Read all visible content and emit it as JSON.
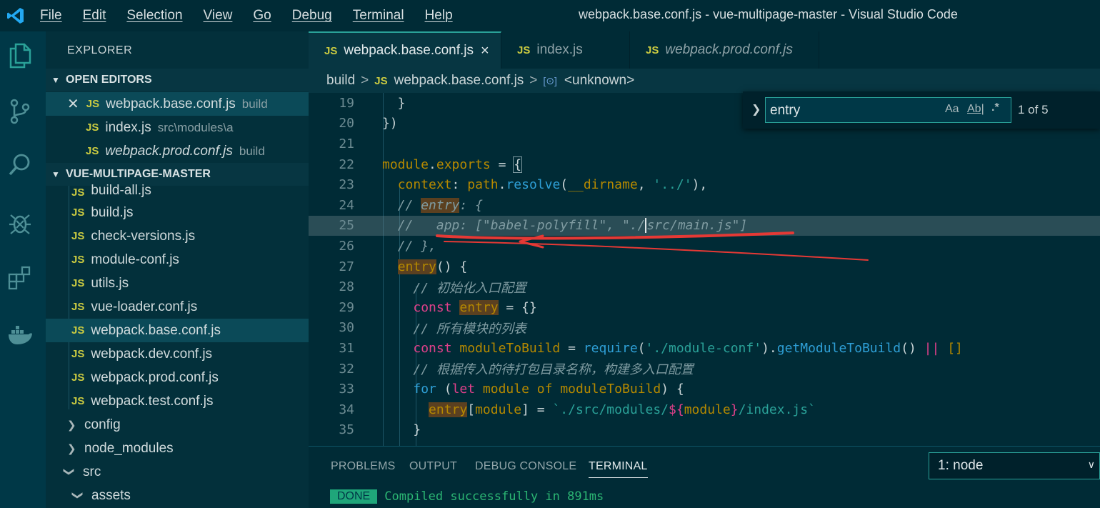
{
  "window": {
    "title": "webpack.base.conf.js - vue-multipage-master - Visual Studio Code"
  },
  "menu": [
    "File",
    "Edit",
    "Selection",
    "View",
    "Go",
    "Debug",
    "Terminal",
    "Help"
  ],
  "sidebar": {
    "title": "EXPLORER",
    "open_editors_label": "OPEN EDITORS",
    "open_editors": [
      {
        "name": "webpack.base.conf.js",
        "desc": "build",
        "icon": "JS"
      },
      {
        "name": "index.js",
        "desc": "src\\modules\\a",
        "icon": "JS"
      },
      {
        "name": "webpack.prod.conf.js",
        "desc": "build",
        "icon": "JS"
      }
    ],
    "project_label": "VUE-MULTIPAGE-MASTER",
    "files": [
      "build-all.js",
      "build.js",
      "check-versions.js",
      "module-conf.js",
      "utils.js",
      "vue-loader.conf.js",
      "webpack.base.conf.js",
      "webpack.dev.conf.js",
      "webpack.prod.conf.js",
      "webpack.test.conf.js"
    ],
    "folders": [
      "config",
      "node_modules",
      "src",
      "assets"
    ]
  },
  "tabs": [
    {
      "label": "webpack.base.conf.js",
      "icon": "JS",
      "close": "×"
    },
    {
      "label": "index.js",
      "icon": "JS"
    },
    {
      "label": "webpack.prod.conf.js",
      "icon": "JS"
    }
  ],
  "breadcrumb": {
    "folder": "build",
    "file": "webpack.base.conf.js",
    "symbol": "<unknown>",
    "sep": ">"
  },
  "find": {
    "value": "entry",
    "match_case": "Aa",
    "whole_word": "Ab|",
    "regex": ".*",
    "count": "1 of 5"
  },
  "editor": {
    "line_numbers": [
      "19",
      "20",
      "21",
      "22",
      "23",
      "24",
      "25",
      "26",
      "27",
      "28",
      "29",
      "30",
      "31",
      "32",
      "33",
      "34",
      "35"
    ]
  },
  "panel": {
    "tabs": [
      "PROBLEMS",
      "OUTPUT",
      "DEBUG CONSOLE",
      "TERMINAL"
    ],
    "terminal_select": "1: node",
    "status_badge": "DONE",
    "message": "Compiled successfully in 891ms"
  },
  "colors": {
    "accent": "#2aa198",
    "annotation": "#e53935",
    "js_icon": "#cbcb41"
  }
}
